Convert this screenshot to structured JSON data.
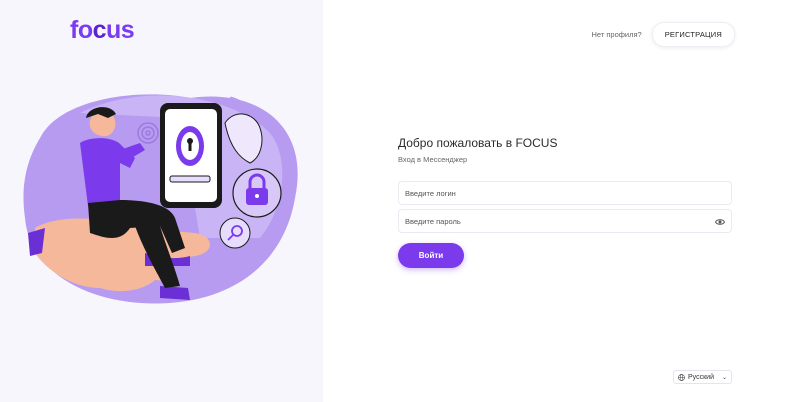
{
  "brand": {
    "logo_prefix": "fo",
    "logo_accent": "c",
    "logo_suffix": "us",
    "accent_color": "#7c3aed"
  },
  "header": {
    "no_profile_text": "Нет профиля?",
    "register_label": "РЕГИСТРАЦИЯ"
  },
  "form": {
    "title": "Добро пожаловать в FOCUS",
    "subtitle": "Вход в Мессенджер",
    "login_placeholder": "Введите логин",
    "password_placeholder": "Введите пароль",
    "submit_label": "Войти"
  },
  "footer": {
    "language": "Русский"
  },
  "icons": {
    "password_toggle": "eye-icon",
    "language": "globe-icon",
    "dropdown": "chevron-down-icon"
  }
}
